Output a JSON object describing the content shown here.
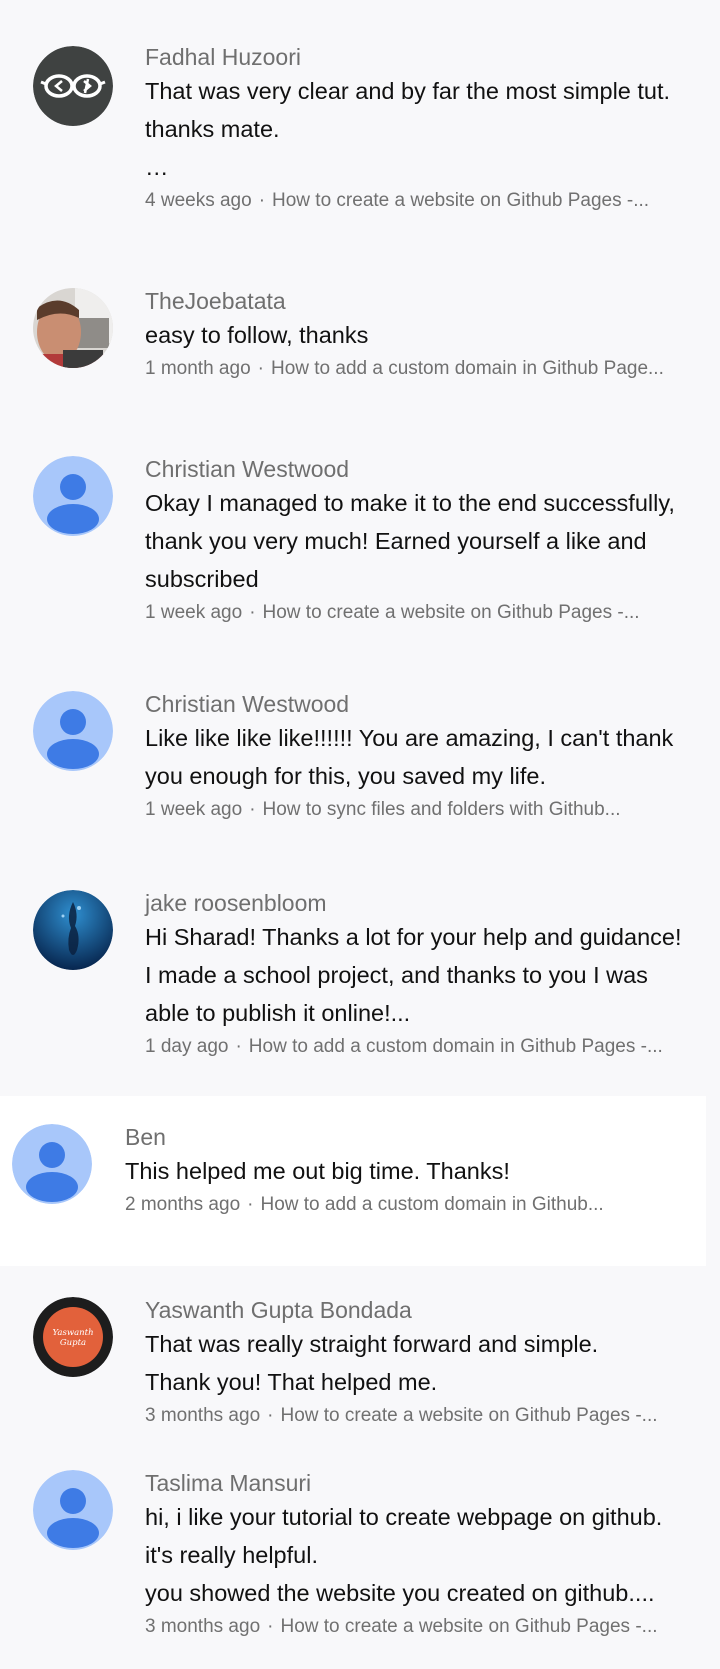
{
  "colors": {
    "background": "#f8f8fa",
    "author": "#6f6f6f",
    "text": "#111111",
    "meta": "#707070",
    "default_avatar_bg": "#a8c7fa",
    "default_avatar_fg": "#3e7be5"
  },
  "meta_separator": "·",
  "comments": [
    {
      "author": "Fadhal Huzoori",
      "avatar": "glasses-avatar",
      "text": [
        "That was very clear and by far the most simple tut.",
        "thanks mate.",
        "…"
      ],
      "time": "4 weeks ago",
      "video": "How to create a website on Github Pages -..."
    },
    {
      "author": "TheJoebatata",
      "avatar": "photo-avatar",
      "text": [
        "easy to follow, thanks"
      ],
      "time": "1 month ago",
      "video": "How to add a custom domain in Github Page..."
    },
    {
      "author": "Christian Westwood",
      "avatar": "default-person-avatar",
      "text": [
        "Okay I managed to make it to the end successfully,",
        "thank you very much! Earned yourself a like and",
        "subscribed"
      ],
      "time": "1 week ago",
      "video": "How to create a website on Github Pages -..."
    },
    {
      "author": "Christian Westwood",
      "avatar": "default-person-avatar",
      "text": [
        "Like like like like!!!!!! You are amazing, I can't thank",
        "you enough for this, you saved my life."
      ],
      "time": "1 week ago",
      "video": "How to sync files and folders with Github..."
    },
    {
      "author": "jake roosenbloom",
      "avatar": "underwater-avatar",
      "text": [
        "Hi Sharad! Thanks a lot for your help and guidance!",
        "I made a school project, and thanks to you I was",
        "able to publish it online!..."
      ],
      "time": "1 day ago",
      "video": "How to add a custom domain in Github Pages -..."
    },
    {
      "author": "Ben",
      "avatar": "default-person-avatar",
      "text": [
        "This helped me out big time. Thanks!"
      ],
      "time": "2 months ago",
      "video": "How to add a custom domain in Github..."
    },
    {
      "author": "Yaswanth Gupta Bondada",
      "avatar": "logo-avatar",
      "avatar_text": [
        "Yaswanth",
        "Gupta"
      ],
      "text": [
        "That was really straight forward and simple.",
        "Thank you! That helped me."
      ],
      "time": "3 months ago",
      "video": "How to create a website on Github Pages -..."
    },
    {
      "author": "Taslima Mansuri",
      "avatar": "default-person-avatar",
      "text": [
        "hi, i like your tutorial to create webpage on github.",
        "it's really helpful.",
        "you showed the website you created on github...."
      ],
      "time": "3 months ago",
      "video": "How to create a website on Github Pages -..."
    }
  ]
}
